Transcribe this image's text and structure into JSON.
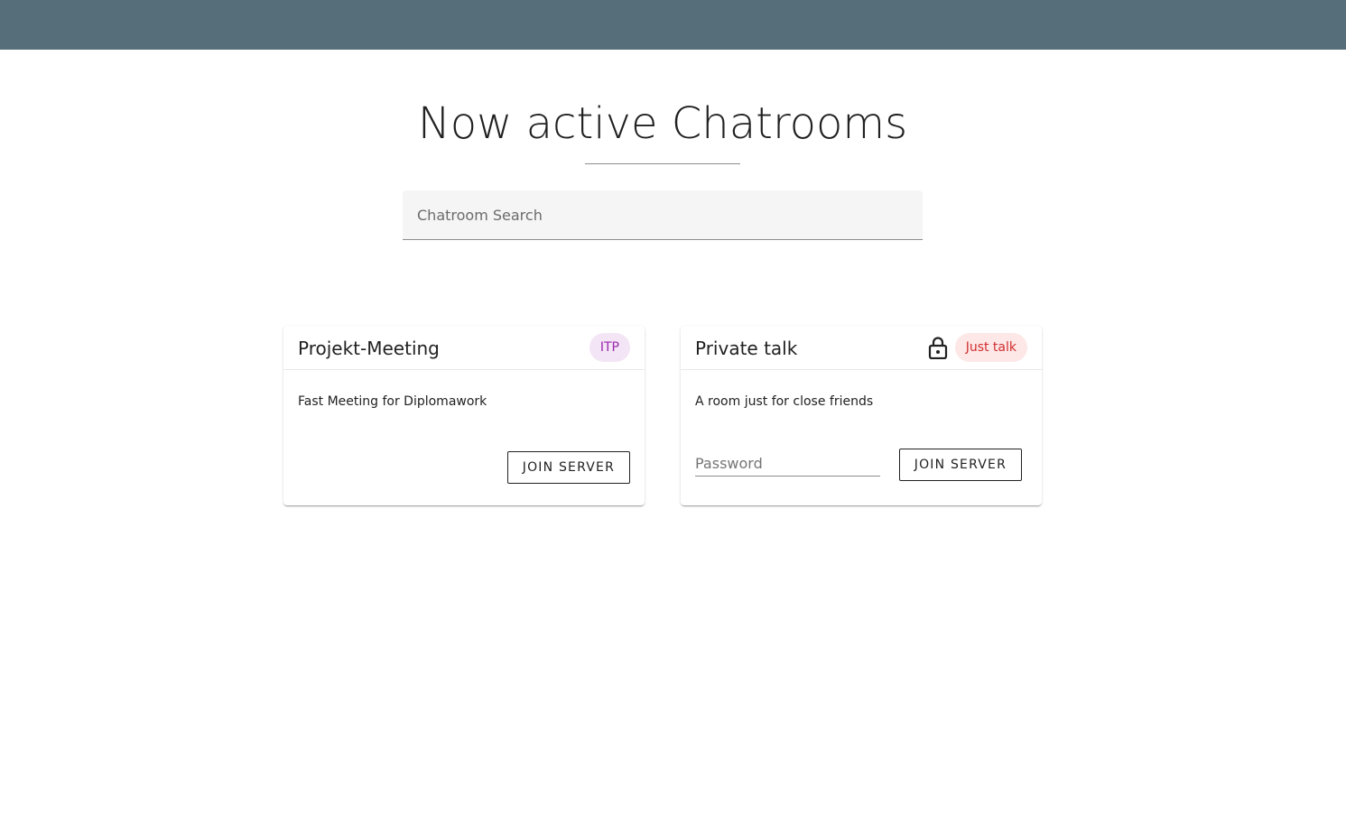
{
  "header": {
    "bar_color": "#566e7a"
  },
  "page": {
    "title": "Now active Chatrooms"
  },
  "search": {
    "placeholder": "Chatroom Search"
  },
  "rooms": [
    {
      "name": "Projekt-Meeting",
      "tag": "ITP",
      "tag_color": "#9c27b0",
      "description": "Fast Meeting for Diplomawork",
      "locked": false,
      "join_label": "JOIN SERVER"
    },
    {
      "name": "Private talk",
      "tag": "Just talk",
      "tag_color": "#d32f2f",
      "description": "A room just for close friends",
      "locked": true,
      "lock_icon": "lock-icon",
      "password_placeholder": "Password",
      "join_label": "JOIN SERVER"
    }
  ]
}
